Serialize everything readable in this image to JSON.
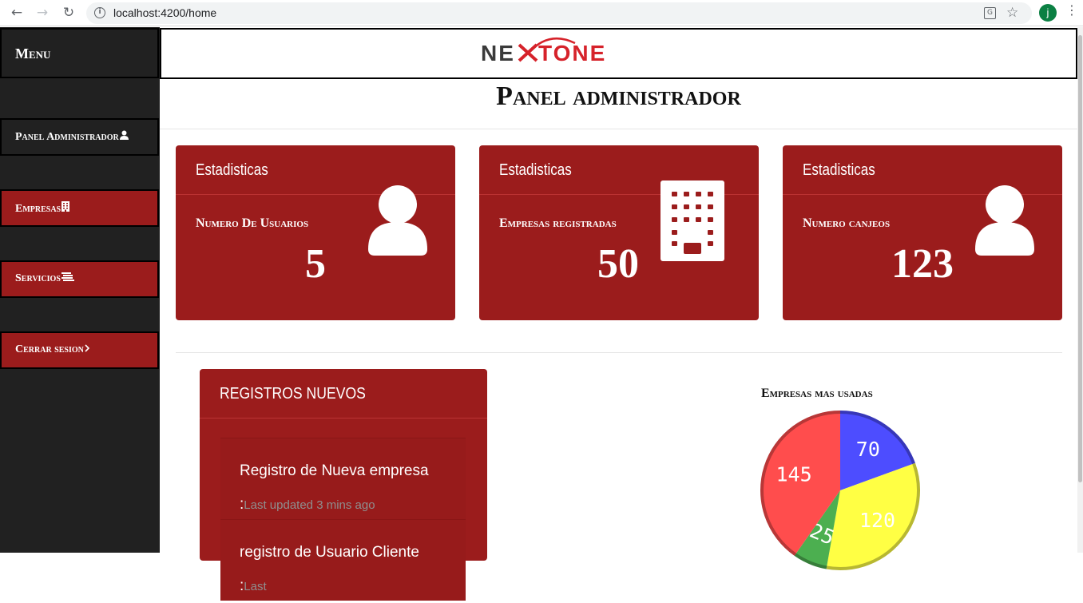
{
  "browser": {
    "url": "localhost:4200/home",
    "avatar_letter": "j"
  },
  "sidebar": {
    "menu_title": "Menu",
    "items": [
      {
        "label": "Panel Administrador",
        "icon": "user-icon"
      },
      {
        "label": "Empresas",
        "icon": "building-icon"
      },
      {
        "label": "Servicios",
        "icon": "list-icon"
      },
      {
        "label": "Cerrar sesion",
        "icon": "chevron-right-icon"
      }
    ]
  },
  "header": {
    "logo": "NEXTONE",
    "page_title": "Panel administrador"
  },
  "cards": [
    {
      "heading": "Estadisticas",
      "label": "Numero De Usuarios",
      "value": "5",
      "icon": "user-icon"
    },
    {
      "heading": "Estadisticas",
      "label": "Empresas registradas",
      "value": "50",
      "icon": "building-icon"
    },
    {
      "heading": "Estadisticas",
      "label": "Numero canjeos",
      "value": "123",
      "icon": "user-icon"
    }
  ],
  "registros": {
    "heading": "REGISTROS NUEVOS",
    "items": [
      {
        "title": "Registro de Nueva empresa :",
        "meta": "Last updated 3 mins ago"
      },
      {
        "title": "registro de Usuario Cliente :",
        "meta": "Last"
      }
    ]
  },
  "chart_data": {
    "type": "pie",
    "title": "Empresas mas usadas",
    "slices": [
      {
        "value": 70,
        "color": "#4d4dff"
      },
      {
        "value": 120,
        "color": "#ffff44"
      },
      {
        "value": 25,
        "color": "#4caf50"
      },
      {
        "value": 145,
        "color": "#ff4d4d"
      }
    ]
  },
  "colors": {
    "sidebar_bg": "#212121",
    "accent_red": "#9b1c1c",
    "brand_red": "#d6222a"
  }
}
